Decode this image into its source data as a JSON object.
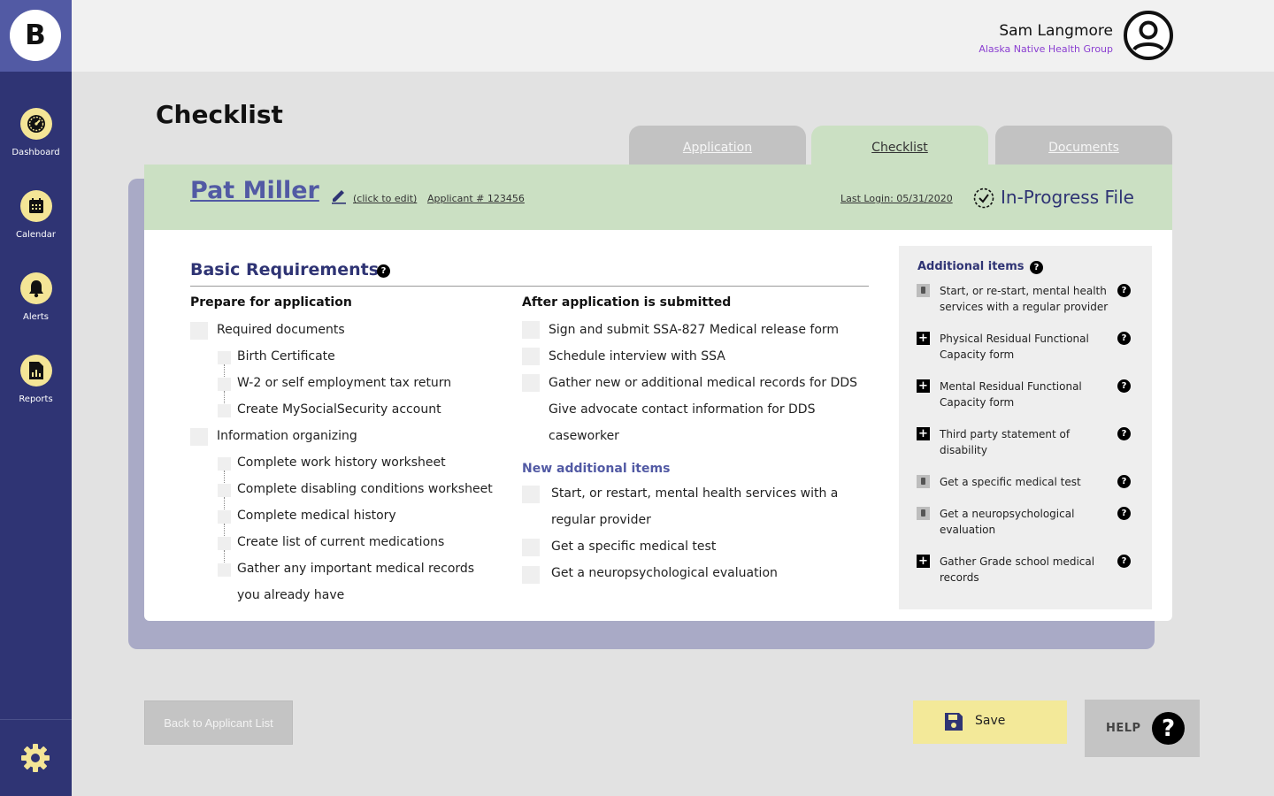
{
  "app": {
    "logo_letter": "B"
  },
  "sidebar": {
    "items": [
      {
        "label": "Dashboard",
        "icon": "dashboard-gauge-icon"
      },
      {
        "label": "Calendar",
        "icon": "calendar-icon"
      },
      {
        "label": "Alerts",
        "icon": "bell-icon"
      },
      {
        "label": "Reports",
        "icon": "report-icon"
      }
    ],
    "settings_icon": "gear-icon"
  },
  "user": {
    "name": "Sam Langmore",
    "org": "Alaska Native Health Group"
  },
  "page": {
    "title": "Checklist"
  },
  "tabs": [
    {
      "label": "Application",
      "active": false
    },
    {
      "label": "Checklist",
      "active": true
    },
    {
      "label": "Documents",
      "active": false
    }
  ],
  "applicant": {
    "name": "Pat Miller",
    "edit_label": "(click to edit)",
    "number": "Applicant # 123456",
    "last_login": "Last Login: 05/31/2020",
    "status": "In-Progress File"
  },
  "basic": {
    "title": "Basic Requirements",
    "prepare": {
      "heading": "Prepare for application",
      "groups": [
        {
          "label": "Required documents",
          "children": [
            "Birth Certificate",
            "W-2 or self employment tax return",
            "Create MySocialSecurity account"
          ]
        },
        {
          "label": "Information organizing",
          "children": [
            "Complete work history worksheet",
            "Complete disabling conditions worksheet",
            "Complete medical history",
            "Create list of current medications",
            "Gather any important medical records",
            "you already have"
          ]
        }
      ]
    },
    "after": {
      "heading": "After application is submitted",
      "items": [
        "Sign and submit SSA-827 Medical release form",
        "Schedule interview with SSA",
        "Gather new or additional medical records for DDS",
        "Give advocate contact information for DDS",
        "caseworker"
      ]
    },
    "new_items": {
      "heading": "New additional items",
      "items": [
        "Start, or restart, mental health services with a",
        "regular provider",
        "Get a specific medical test",
        "Get a neuropsychological evaluation"
      ]
    }
  },
  "additional": {
    "title": "Additional items",
    "items": [
      {
        "text": "Start, or re-start, mental health services with a regular provider",
        "icon": "added-icon"
      },
      {
        "text": "Physical Residual Functional Capacity form",
        "icon": "plus-icon"
      },
      {
        "text": "Mental Residual Functional Capacity form",
        "icon": "plus-icon"
      },
      {
        "text": "Third party statement of disability",
        "icon": "plus-icon"
      },
      {
        "text": "Get a specific medical test",
        "icon": "added-icon"
      },
      {
        "text": "Get a neuropsychological evaluation",
        "icon": "added-icon"
      },
      {
        "text": "Gather Grade school medical records",
        "icon": "plus-icon"
      }
    ]
  },
  "footer": {
    "back_label": "Back to Applicant List",
    "save_label": "Save",
    "help_label": "HELP"
  },
  "colors": {
    "sidebar": "#2f3474",
    "accent": "#525aa4",
    "header_green": "#cbe0c3",
    "nav_icon_bg": "#f4e596",
    "save_bg": "#f3e999"
  }
}
